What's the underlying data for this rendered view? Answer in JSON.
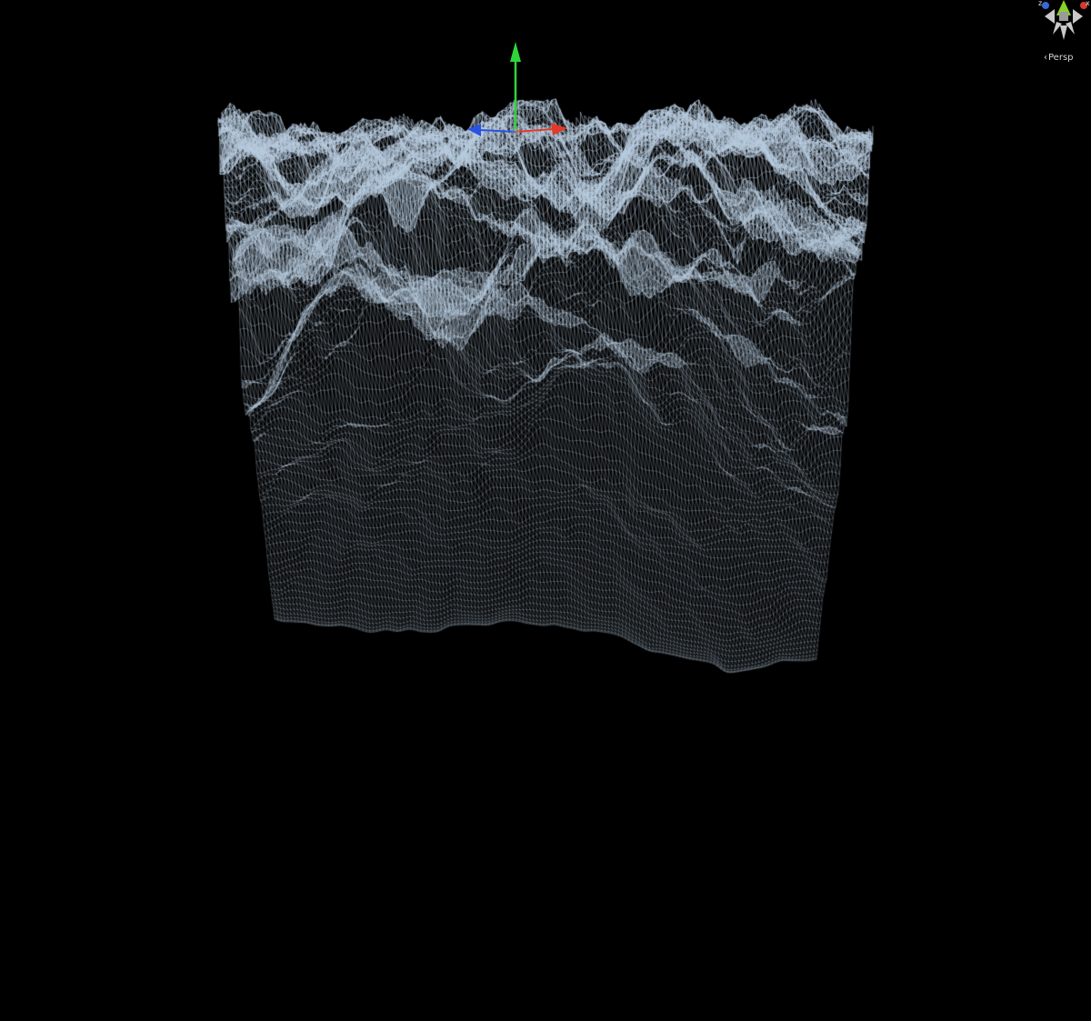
{
  "scene_view": {
    "projection_label": "Persp",
    "projection_chevron": "‹",
    "orientation_gizmo": {
      "x_letter": "x",
      "z_letter": "z",
      "x_axis_color": "#d83a2a",
      "y_axis_color": "#8bd12c",
      "z_axis_color": "#3a67dc",
      "neutral_color": "#c9c9c9"
    },
    "move_tool": {
      "x_handle_color": "#e03a2a",
      "y_handle_color": "#2fd43a",
      "z_handle_color": "#2a52e0"
    },
    "background_color": "#000000",
    "wireframe_color": "#b8ccdf",
    "render_mode": "wireframe"
  }
}
